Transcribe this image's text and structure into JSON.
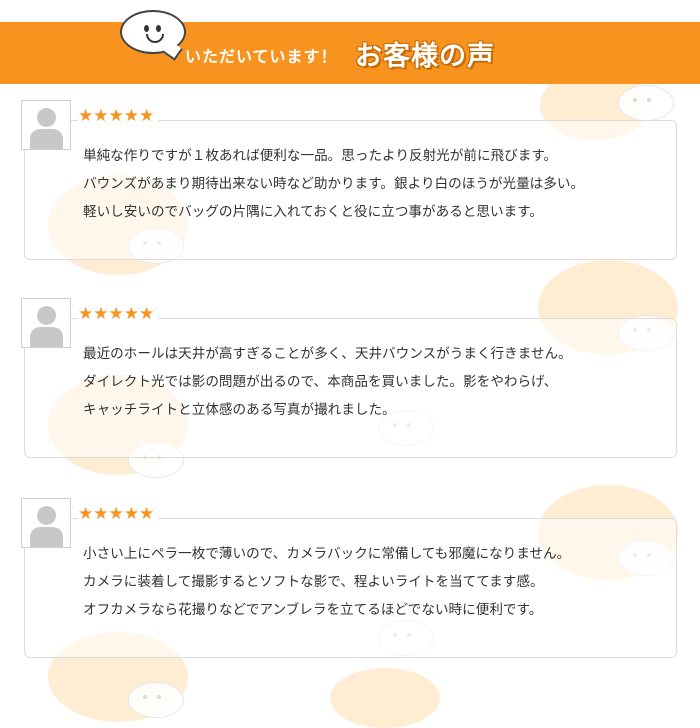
{
  "header": {
    "subtitle": "いただいています！",
    "title": "お客様の声"
  },
  "colors": {
    "accent": "#f7931e",
    "star": "#f7931e",
    "cloud": "#fde7c4"
  },
  "reviews": [
    {
      "rating": "★★★★★",
      "lines": [
        "単純な作りですが１枚あれば便利な一品。思ったより反射光が前に飛びます。",
        "バウンズがあまり期待出来ない時など助かります。銀より白のほうが光量は多い。",
        "軽いし安いのでバッグの片隅に入れておくと役に立つ事があると思います。"
      ]
    },
    {
      "rating": "★★★★★",
      "lines": [
        "最近のホールは天井が高すぎることが多く、天井バウンスがうまく行きません。",
        "ダイレクト光では影の問題が出るので、本商品を買いました。影をやわらげ、",
        "キャッチライトと立体感のある写真が撮れました。"
      ]
    },
    {
      "rating": "★★★★★",
      "lines": [
        "小さい上にペラ一枚で薄いので、カメラバックに常備しても邪魔になりません。",
        "カメラに装着して撮影するとソフトな影で、程よいライトを当ててます感。",
        "オフカメラなら花撮りなどでアンブレラを立てるほどでない時に便利です。"
      ]
    }
  ]
}
